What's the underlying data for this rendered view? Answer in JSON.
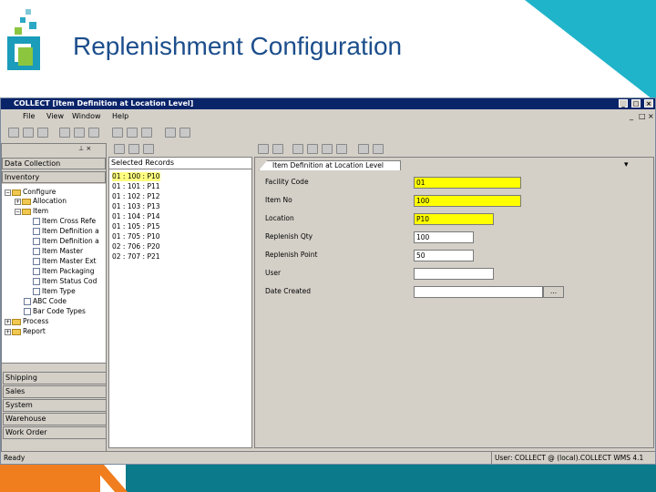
{
  "slide": {
    "title": "Replenishment Configuration"
  },
  "window": {
    "title": "COLLECT  [Item Definition at Location Level]"
  },
  "menu": [
    "File",
    "View",
    "Window",
    "Help"
  ],
  "left_panel": {
    "header": "Data Collection",
    "section": "Inventory",
    "tree": [
      "Configure",
      "Allocation",
      "Item",
      "Item Cross Refe",
      "Item Definition a",
      "Item Definition a",
      "Item Master",
      "Item Master Ext",
      "Item Packaging",
      "Item Status Cod",
      "Item Type",
      "ABC Code",
      "Bar Code Types",
      "Process",
      "Report"
    ],
    "nav_buttons": [
      "Shipping",
      "Sales",
      "System",
      "Warehouse",
      "Work Order"
    ]
  },
  "records": {
    "header": "Selected Records",
    "items": [
      "01 : 100 : P10",
      "01 : 101 : P11",
      "01 : 102 : P12",
      "01 : 103 : P13",
      "01 : 104 : P14",
      "01 : 105 : P15",
      "01 : 705 : P10",
      "02 : 706 : P20",
      "02 : 707 : P21"
    ]
  },
  "form": {
    "tab": "Item Definition at Location Level",
    "fields": [
      {
        "label": "Facility Code",
        "value": "01"
      },
      {
        "label": "Item No",
        "value": "100"
      },
      {
        "label": "Location",
        "value": "P10"
      },
      {
        "label": "Replenish Qty",
        "value": "100"
      },
      {
        "label": "Replenish Point",
        "value": "50"
      },
      {
        "label": "User",
        "value": ""
      },
      {
        "label": "Date Created",
        "value": ""
      }
    ],
    "ellipsis": "..."
  },
  "status": {
    "left": "Ready",
    "right": "User: COLLECT @ (local).COLLECT WMS 4.1"
  },
  "colors": {
    "title": "#1c4e8c",
    "accent": "#1fb4c9",
    "orange": "#f07e1f",
    "teal": "#0b7a8a",
    "required_field": "#ffff00"
  }
}
